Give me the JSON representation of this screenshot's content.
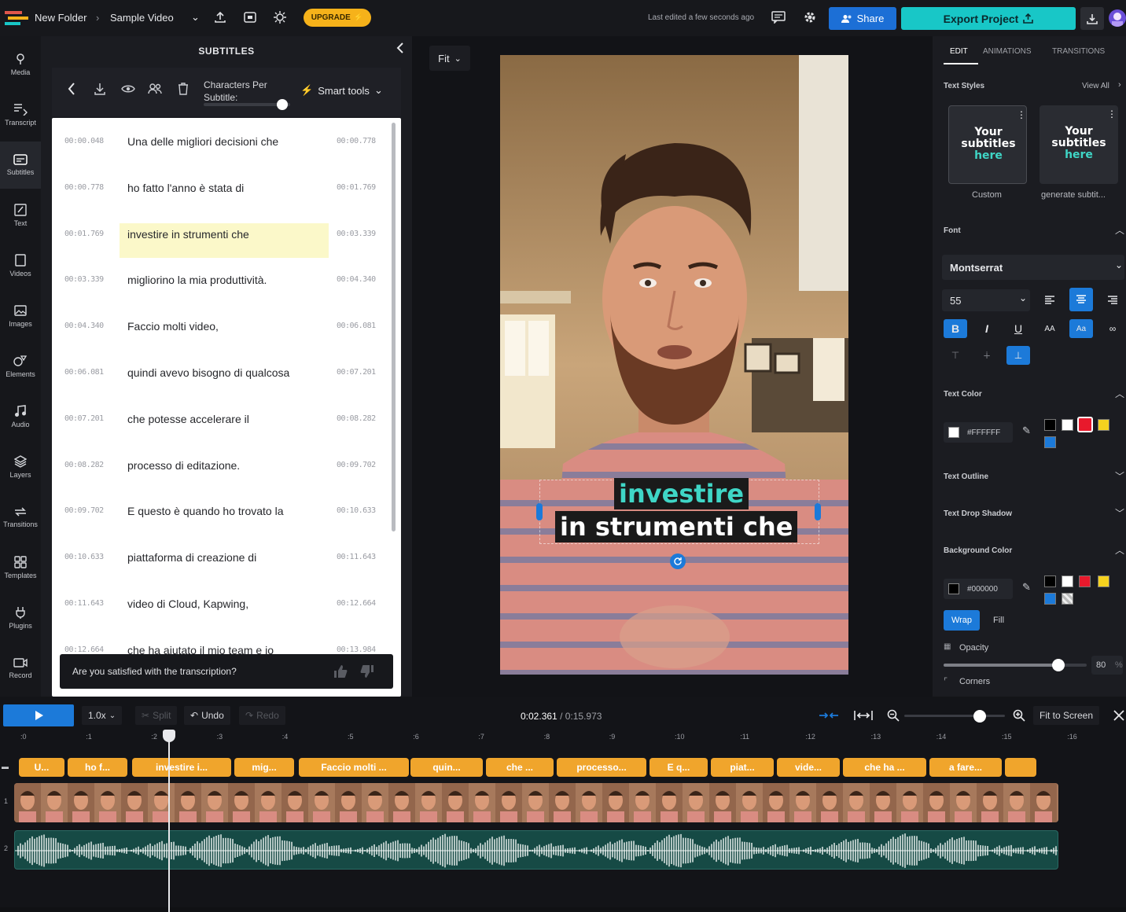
{
  "topbar": {
    "folder": "New Folder",
    "project": "Sample Video",
    "upgrade_label": "UPGRADE",
    "last_edited": "Last edited a few seconds ago",
    "share_label": "Share",
    "export_label": "Export Project"
  },
  "rail": [
    {
      "label": "Media",
      "icon": "media-icon"
    },
    {
      "label": "Transcript",
      "icon": "transcript-icon"
    },
    {
      "label": "Subtitles",
      "icon": "subtitles-icon"
    },
    {
      "label": "Text",
      "icon": "text-icon"
    },
    {
      "label": "Videos",
      "icon": "videos-icon"
    },
    {
      "label": "Images",
      "icon": "images-icon"
    },
    {
      "label": "Elements",
      "icon": "elements-icon"
    },
    {
      "label": "Audio",
      "icon": "audio-icon"
    },
    {
      "label": "Layers",
      "icon": "layers-icon"
    },
    {
      "label": "Transitions",
      "icon": "transitions-icon"
    },
    {
      "label": "Templates",
      "icon": "templates-icon"
    },
    {
      "label": "Plugins",
      "icon": "plugins-icon"
    },
    {
      "label": "Record",
      "icon": "record-icon"
    }
  ],
  "subtitles": {
    "title": "SUBTITLES",
    "chars_label": "Characters Per Subtitle:",
    "chars_slider_fraction": 0.04,
    "smart_tools": "Smart tools",
    "feedback_question": "Are you satisfied with the transcription?",
    "rows": [
      {
        "start": "00:00.048",
        "text": "Una delle migliori decisioni che",
        "end": "00:00.778"
      },
      {
        "start": "00:00.778",
        "text": "ho fatto l'anno è stata di",
        "end": "00:01.769"
      },
      {
        "start": "00:01.769",
        "text": "investire in strumenti che",
        "end": "00:03.339"
      },
      {
        "start": "00:03.339",
        "text": "migliorino la mia produttività.",
        "end": "00:04.340"
      },
      {
        "start": "00:04.340",
        "text": "Faccio molti video,",
        "end": "00:06.081"
      },
      {
        "start": "00:06.081",
        "text": "quindi avevo bisogno di qualcosa",
        "end": "00:07.201"
      },
      {
        "start": "00:07.201",
        "text": "che potesse accelerare il",
        "end": "00:08.282"
      },
      {
        "start": "00:08.282",
        "text": "processo di editazione.",
        "end": "00:09.702"
      },
      {
        "start": "00:09.702",
        "text": "E questo è quando ho trovato la",
        "end": "00:10.633"
      },
      {
        "start": "00:10.633",
        "text": "piattaforma di creazione di",
        "end": "00:11.643"
      },
      {
        "start": "00:11.643",
        "text": "video di Cloud, Kapwing,",
        "end": "00:12.664"
      },
      {
        "start": "00:12.664",
        "text": "che ha aiutato il mio team e io",
        "end": "00:13.984"
      }
    ],
    "highlighted_index": 2
  },
  "canvas": {
    "fit_label": "Fit",
    "caption_line1": "investire",
    "caption_line2": "in strumenti che"
  },
  "right": {
    "tabs": [
      "EDIT",
      "ANIMATIONS",
      "TRANSITIONS"
    ],
    "text_styles": "Text Styles",
    "view_all": "View All",
    "style_sample": [
      "Your",
      "subtitles",
      "here"
    ],
    "card_custom": "Custom",
    "card_generate": "generate subtit...",
    "font_section": "Font",
    "font_name": "Montserrat",
    "font_size": "55",
    "text_color_section": "Text Color",
    "text_color_value": "#FFFFFF",
    "text_outline": "Text Outline",
    "text_drop_shadow": "Text Drop Shadow",
    "background_color": "Background Color",
    "bg_color_value": "#000000",
    "wrap": "Wrap",
    "fill": "Fill",
    "opacity": "Opacity",
    "opacity_value": "80",
    "opacity_unit": "%",
    "corners": "Corners",
    "swatches": [
      "#000000",
      "#ffffff",
      "#e8192c",
      "#f5d21f",
      "#1c7ad9"
    ]
  },
  "timeline": {
    "speed": "1.0x",
    "split": "Split",
    "undo": "Undo",
    "redo": "Redo",
    "current_time": "0:02.361",
    "total_time": "/ 0:15.973",
    "fit_to_screen": "Fit to Screen",
    "zoom_fraction": 0.75,
    "ticks": [
      ":0",
      ":1",
      ":2",
      ":3",
      ":4",
      ":5",
      ":6",
      ":7",
      ":8",
      ":9",
      ":10",
      ":11",
      ":12",
      ":13",
      ":14",
      ":15",
      ":16"
    ],
    "clips": [
      "U...",
      "ho f...",
      "investire i...",
      "mig...",
      "Faccio molti ...",
      "quin...",
      "che ...",
      "processo...",
      "E q...",
      "piat...",
      "vide...",
      "che ha ...",
      "a fare...",
      ""
    ],
    "track_labels": [
      "1",
      "2"
    ]
  },
  "colors": {
    "accent_blue": "#1c7ad9",
    "export_teal": "#18c7c7",
    "upgrade_yellow": "#f6b21a",
    "clip_orange": "#f0a52c",
    "caption_teal": "#3fd6c6"
  }
}
